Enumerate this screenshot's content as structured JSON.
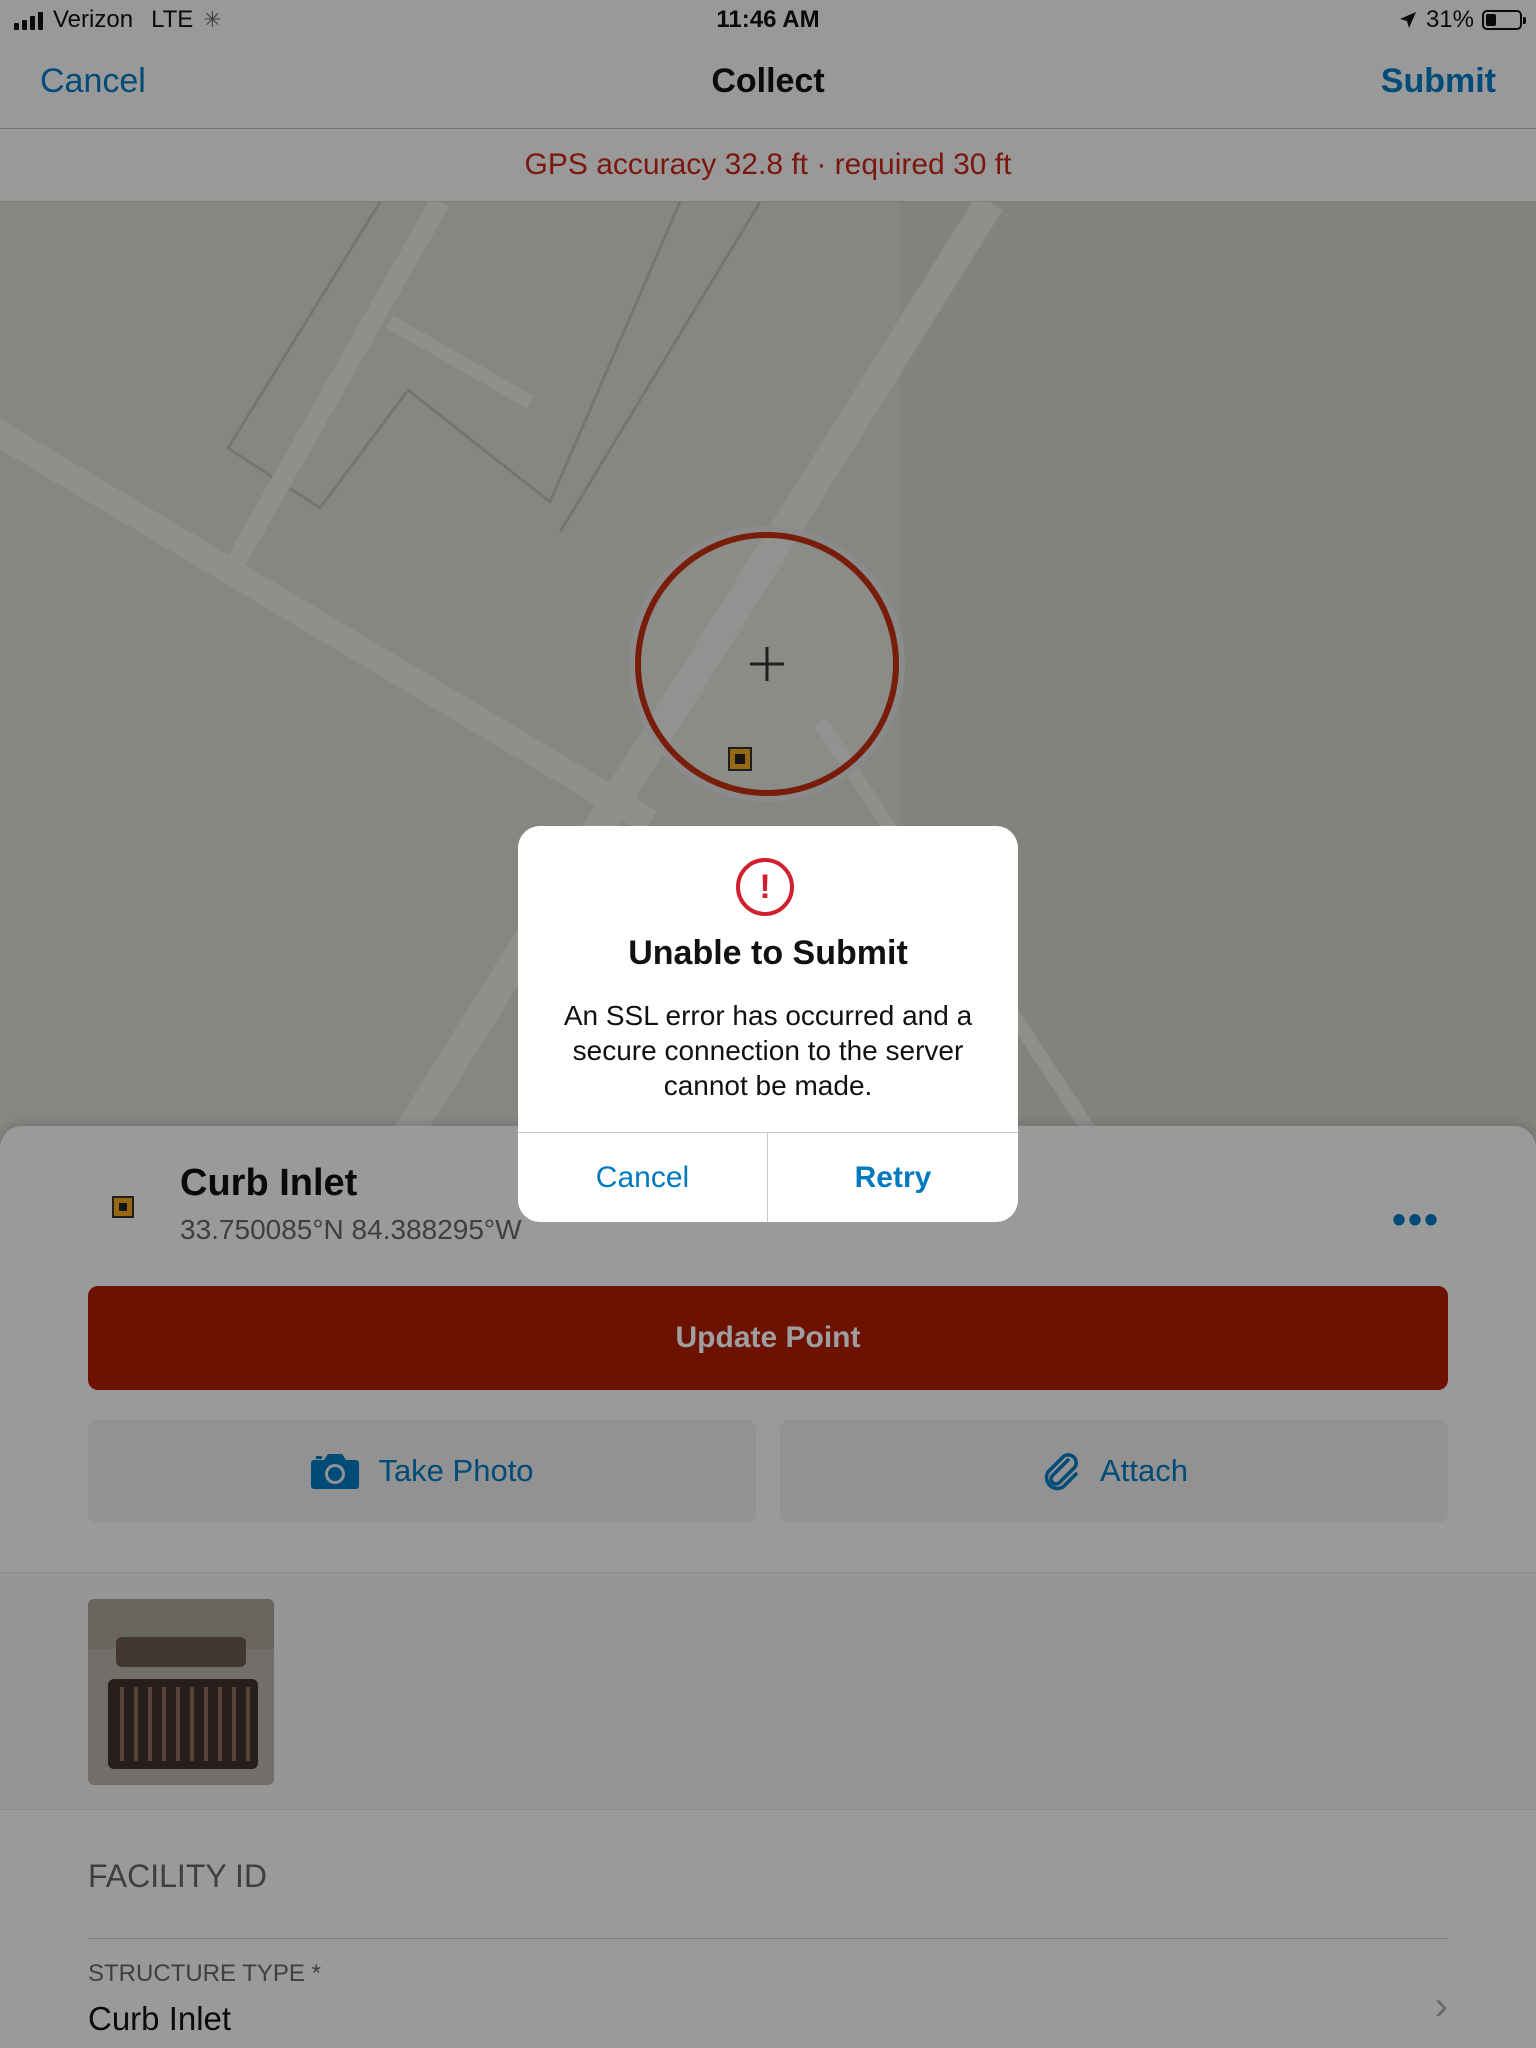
{
  "status_bar": {
    "carrier": "Verizon",
    "network": "LTE",
    "time": "11:46 AM",
    "battery": "31%",
    "battery_level": 0.31
  },
  "nav": {
    "cancel_label": "Cancel",
    "title": "Collect",
    "submit_label": "Submit"
  },
  "gps_banner": "GPS accuracy 32.8 ft · required 30 ft",
  "feature": {
    "title": "Curb Inlet",
    "coordinates": "33.750085°N  84.388295°W",
    "more_label": "•••"
  },
  "actions": {
    "update_label": "Update Point",
    "take_photo_label": "Take Photo",
    "attach_label": "Attach"
  },
  "form": {
    "facility_id_label": "FACILITY ID",
    "structure_type_label": "STRUCTURE TYPE *",
    "structure_type_value": "Curb Inlet"
  },
  "dialog": {
    "title": "Unable to Submit",
    "message": "An SSL error has occurred and a secure connection to the server cannot be made.",
    "cancel_label": "Cancel",
    "retry_label": "Retry"
  },
  "icons": {
    "alert": "alert-icon",
    "camera": "camera-icon",
    "paperclip": "paperclip-icon",
    "location_arrow": "location-arrow-icon",
    "chevron": "chevron-right-icon"
  },
  "colors": {
    "accent": "#0079c1",
    "update_button": "#b01c00",
    "error_red": "#c8261b",
    "alert_red": "#d0202f",
    "feature_symbol": "#f0a81c"
  }
}
